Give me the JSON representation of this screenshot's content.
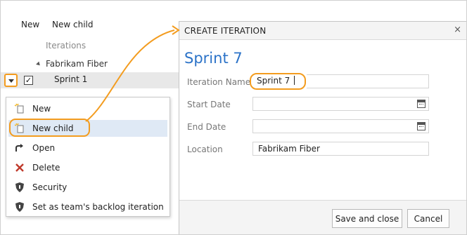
{
  "toolbar": {
    "new_label": "New",
    "new_child_label": "New child"
  },
  "tree": {
    "header": "Iterations",
    "root": "Fabrikam Fiber",
    "selected": "Sprint 1"
  },
  "context_menu": {
    "items": [
      {
        "label": "New",
        "icon": "new-item-icon"
      },
      {
        "label": "New child",
        "icon": "new-child-icon"
      },
      {
        "label": "Open",
        "icon": "open-arrow-icon"
      },
      {
        "label": "Delete",
        "icon": "delete-x-icon"
      },
      {
        "label": "Security",
        "icon": "shield-icon"
      },
      {
        "label": "Set as team's backlog iteration",
        "icon": "shield-icon"
      }
    ]
  },
  "dialog": {
    "title": "CREATE ITERATION",
    "close_glyph": "×",
    "heading": "Sprint 7",
    "fields": {
      "name_label": "Iteration Name",
      "name_value": "Sprint 7",
      "start_label": "Start Date",
      "start_value": "",
      "end_label": "End Date",
      "end_value": "",
      "location_label": "Location",
      "location_value": "Fabrikam Fiber"
    },
    "save_label": "Save and close",
    "cancel_label": "Cancel"
  },
  "colors": {
    "accent_orange": "#f39c1f",
    "title_blue": "#2c73c8",
    "delete_red": "#c0392b",
    "highlight": "#dfe9f5"
  }
}
